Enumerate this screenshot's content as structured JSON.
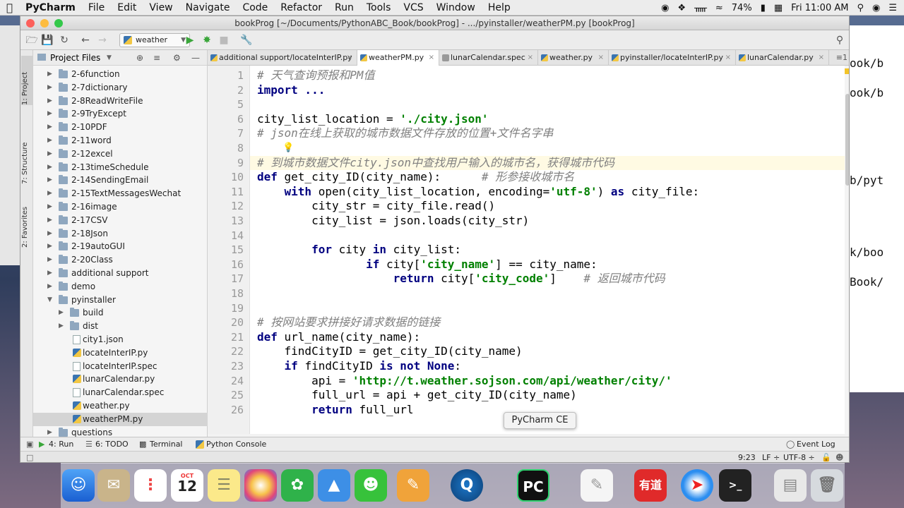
{
  "menubar": {
    "apple": "",
    "app_name": "PyCharm",
    "items": [
      "File",
      "Edit",
      "View",
      "Navigate",
      "Code",
      "Refactor",
      "Run",
      "Tools",
      "VCS",
      "Window",
      "Help"
    ],
    "battery": "74%",
    "clock": "Fri 11:00 AM"
  },
  "window": {
    "title": "bookProg [~/Documents/PythonABC_Book/bookProg] - .../pyinstaller/weatherPM.py [bookProg]"
  },
  "toolbar": {
    "run_config": "weather"
  },
  "side_tabs": {
    "project": "1: Project",
    "structure": "7: Structure",
    "favorites": "2: Favorites"
  },
  "project_panel": {
    "header": "Project Files",
    "tree": [
      {
        "label": "2-6function",
        "kind": "folder",
        "depth": 1,
        "open": false
      },
      {
        "label": "2-7dictionary",
        "kind": "folder",
        "depth": 1,
        "open": false
      },
      {
        "label": "2-8ReadWriteFile",
        "kind": "folder",
        "depth": 1,
        "open": false
      },
      {
        "label": "2-9TryExcept",
        "kind": "folder",
        "depth": 1,
        "open": false
      },
      {
        "label": "2-10PDF",
        "kind": "folder",
        "depth": 1,
        "open": false
      },
      {
        "label": "2-11word",
        "kind": "folder",
        "depth": 1,
        "open": false
      },
      {
        "label": "2-12excel",
        "kind": "folder",
        "depth": 1,
        "open": false
      },
      {
        "label": "2-13timeSchedule",
        "kind": "folder",
        "depth": 1,
        "open": false
      },
      {
        "label": "2-14SendingEmail",
        "kind": "folder",
        "depth": 1,
        "open": false
      },
      {
        "label": "2-15TextMessagesWechat",
        "kind": "folder",
        "depth": 1,
        "open": false
      },
      {
        "label": "2-16image",
        "kind": "folder",
        "depth": 1,
        "open": false
      },
      {
        "label": "2-17CSV",
        "kind": "folder",
        "depth": 1,
        "open": false
      },
      {
        "label": "2-18Json",
        "kind": "folder",
        "depth": 1,
        "open": false
      },
      {
        "label": "2-19autoGUI",
        "kind": "folder",
        "depth": 1,
        "open": false
      },
      {
        "label": "2-20Class",
        "kind": "folder",
        "depth": 1,
        "open": false
      },
      {
        "label": "additional support",
        "kind": "folder",
        "depth": 1,
        "open": false
      },
      {
        "label": "demo",
        "kind": "folder",
        "depth": 1,
        "open": false
      },
      {
        "label": "pyinstaller",
        "kind": "folder",
        "depth": 1,
        "open": true
      },
      {
        "label": "build",
        "kind": "folder",
        "depth": 2,
        "open": false
      },
      {
        "label": "dist",
        "kind": "folder",
        "depth": 2,
        "open": false
      },
      {
        "label": "city1.json",
        "kind": "file",
        "depth": 2
      },
      {
        "label": "locateInterIP.py",
        "kind": "py",
        "depth": 2
      },
      {
        "label": "locateInterIP.spec",
        "kind": "file",
        "depth": 2
      },
      {
        "label": "lunarCalendar.py",
        "kind": "py",
        "depth": 2
      },
      {
        "label": "lunarCalendar.spec",
        "kind": "file",
        "depth": 2
      },
      {
        "label": "weather.py",
        "kind": "py",
        "depth": 2
      },
      {
        "label": "weatherPM.py",
        "kind": "py",
        "depth": 2,
        "selected": true
      },
      {
        "label": "questions",
        "kind": "folder",
        "depth": 1,
        "open": false
      }
    ]
  },
  "tabs": [
    {
      "label": "additional support/locateInterIP.py",
      "active": false
    },
    {
      "label": "weatherPM.py",
      "active": true
    },
    {
      "label": "lunarCalendar.spec",
      "active": false
    },
    {
      "label": "weather.py",
      "active": false
    },
    {
      "label": "pyinstaller/locateInterIP.py",
      "active": false
    },
    {
      "label": "lunarCalendar.py",
      "active": false
    }
  ],
  "tabs_overflow": "≡1",
  "editor": {
    "lines": [
      {
        "n": "1",
        "segs": [
          {
            "t": "# 天气查询预报和PM值",
            "c": "cm"
          }
        ]
      },
      {
        "n": "2",
        "segs": [
          {
            "t": "import ...",
            "c": "kw"
          }
        ]
      },
      {
        "n": "5",
        "segs": [
          {
            "t": "",
            "c": ""
          }
        ]
      },
      {
        "n": "6",
        "segs": [
          {
            "t": "city_list_location = ",
            "c": ""
          },
          {
            "t": "'./city.json'",
            "c": "str"
          }
        ]
      },
      {
        "n": "7",
        "segs": [
          {
            "t": "# json在线上获取的城市数据文件存放的位置+文件名字串",
            "c": "cm"
          }
        ]
      },
      {
        "n": "8",
        "segs": [
          {
            "t": "",
            "c": ""
          }
        ]
      },
      {
        "n": "9",
        "segs": [
          {
            "t": "# 到城市数据文件city.json中查找用户输入的城市名，获得城市代码",
            "c": "cm"
          }
        ],
        "current": true
      },
      {
        "n": "10",
        "segs": [
          {
            "t": "def ",
            "c": "kw"
          },
          {
            "t": "get_city_ID(city_name):      ",
            "c": ""
          },
          {
            "t": "# 形参接收城市名",
            "c": "cm"
          }
        ]
      },
      {
        "n": "11",
        "segs": [
          {
            "t": "    ",
            "c": ""
          },
          {
            "t": "with ",
            "c": "kw"
          },
          {
            "t": "open(city_list_location, encoding=",
            "c": ""
          },
          {
            "t": "'utf-8'",
            "c": "str"
          },
          {
            "t": ") ",
            "c": ""
          },
          {
            "t": "as ",
            "c": "kw"
          },
          {
            "t": "city_file:",
            "c": ""
          }
        ]
      },
      {
        "n": "12",
        "segs": [
          {
            "t": "        city_str = city_file.read()",
            "c": ""
          }
        ]
      },
      {
        "n": "13",
        "segs": [
          {
            "t": "        city_list = json.loads(city_str)",
            "c": ""
          }
        ]
      },
      {
        "n": "14",
        "segs": [
          {
            "t": "",
            "c": ""
          }
        ]
      },
      {
        "n": "15",
        "segs": [
          {
            "t": "        ",
            "c": ""
          },
          {
            "t": "for ",
            "c": "kw"
          },
          {
            "t": "city ",
            "c": ""
          },
          {
            "t": "in ",
            "c": "kw"
          },
          {
            "t": "city_list:",
            "c": ""
          }
        ]
      },
      {
        "n": "16",
        "segs": [
          {
            "t": "                ",
            "c": ""
          },
          {
            "t": "if ",
            "c": "kw"
          },
          {
            "t": "city[",
            "c": ""
          },
          {
            "t": "'city_name'",
            "c": "str"
          },
          {
            "t": "] == city_name:",
            "c": ""
          }
        ]
      },
      {
        "n": "17",
        "segs": [
          {
            "t": "                    ",
            "c": ""
          },
          {
            "t": "return ",
            "c": "kw"
          },
          {
            "t": "city[",
            "c": ""
          },
          {
            "t": "'city_code'",
            "c": "str"
          },
          {
            "t": "]    ",
            "c": ""
          },
          {
            "t": "# 返回城市代码",
            "c": "cm"
          }
        ]
      },
      {
        "n": "18",
        "segs": [
          {
            "t": "",
            "c": ""
          }
        ]
      },
      {
        "n": "19",
        "segs": [
          {
            "t": "",
            "c": ""
          }
        ]
      },
      {
        "n": "20",
        "segs": [
          {
            "t": "# 按网站要求拼接好请求数据的链接",
            "c": "cm"
          }
        ]
      },
      {
        "n": "21",
        "segs": [
          {
            "t": "def ",
            "c": "kw"
          },
          {
            "t": "url_name(city_name):",
            "c": ""
          }
        ]
      },
      {
        "n": "22",
        "segs": [
          {
            "t": "    findCityID = get_city_ID(city_name)",
            "c": ""
          }
        ]
      },
      {
        "n": "23",
        "segs": [
          {
            "t": "    ",
            "c": ""
          },
          {
            "t": "if ",
            "c": "kw"
          },
          {
            "t": "findCityID ",
            "c": ""
          },
          {
            "t": "is not None",
            "c": "kw"
          },
          {
            "t": ":",
            "c": ""
          }
        ]
      },
      {
        "n": "24",
        "segs": [
          {
            "t": "        api = ",
            "c": ""
          },
          {
            "t": "'http://t.weather.sojson.com/api/weather/city/'",
            "c": "str"
          }
        ]
      },
      {
        "n": "25",
        "segs": [
          {
            "t": "        full_url = api + get_city_ID(city_name)",
            "c": ""
          }
        ]
      },
      {
        "n": "26",
        "segs": [
          {
            "t": "        ",
            "c": ""
          },
          {
            "t": "return ",
            "c": "kw"
          },
          {
            "t": "full_url",
            "c": ""
          }
        ]
      }
    ]
  },
  "bottom_tools": {
    "run": "4: Run",
    "todo": "6: TODO",
    "terminal": "Terminal",
    "python_console": "Python Console",
    "event_log": "Event Log"
  },
  "status": {
    "position": "9:23",
    "line_sep": "LF ÷",
    "encoding": "UTF-8 ÷"
  },
  "tooltip": "PyCharm CE",
  "background_window": {
    "lines": [
      "ook/b",
      "ook/b",
      "b/pyt",
      "k/boo",
      "Book/"
    ]
  },
  "dock": {
    "calendar_month": "OCT",
    "calendar_day": "12",
    "pycharm_label": "PC",
    "youdao_label": "有道"
  },
  "colors": {
    "keyword": "#000080",
    "string": "#008000",
    "comment": "#808080",
    "current_line": "#fffae3"
  }
}
